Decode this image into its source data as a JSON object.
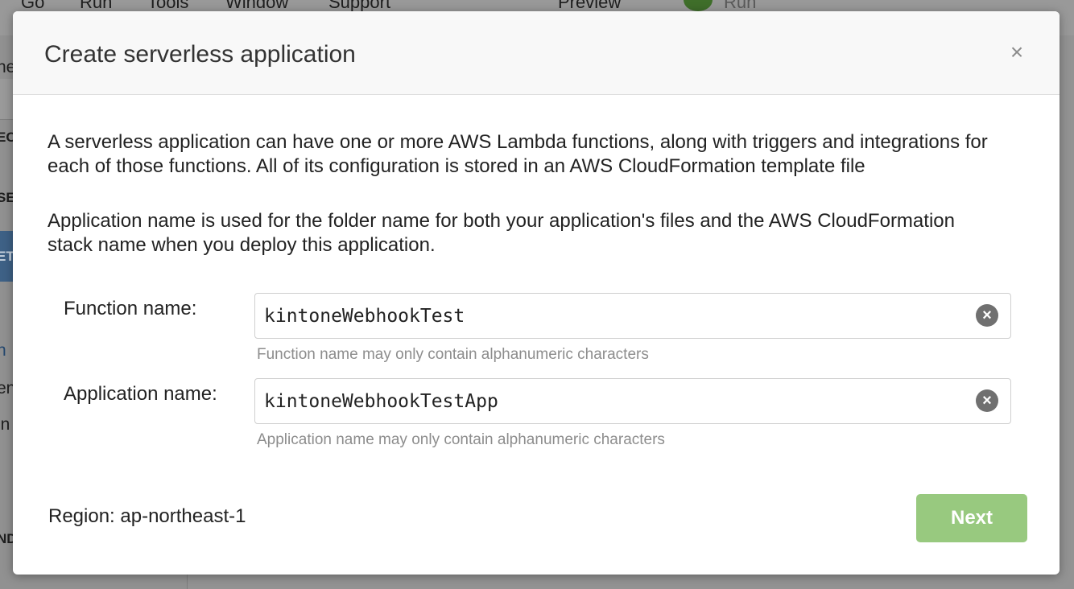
{
  "background": {
    "menu": [
      "Go",
      "Run",
      "Tools",
      "Window",
      "Support"
    ],
    "preview_label": "Preview",
    "run_label": "Run",
    "sidebar_fragments": [
      "ne",
      "EC",
      "SE",
      "ET",
      "n",
      "en",
      "in",
      "ND"
    ]
  },
  "dialog": {
    "title": "Create serverless application",
    "close_symbol": "×",
    "description_1": "A serverless application can have one or more AWS Lambda functions, along with triggers and integrations for each of those functions. All of its configuration is stored in an AWS CloudFormation template file",
    "description_2": "Application name is used for the folder name for both your application's files and the AWS CloudFormation stack name when you deploy this application.",
    "function_field": {
      "label": "Function name:",
      "value": "kintoneWebhookTest",
      "hint": "Function name may only contain alphanumeric characters",
      "clear_symbol": "×"
    },
    "application_field": {
      "label": "Application name:",
      "value": "kintoneWebhookTestApp",
      "hint": "Application name may only contain alphanumeric characters",
      "clear_symbol": "×"
    },
    "region": "Region: ap-northeast-1",
    "next_label": "Next"
  },
  "colors": {
    "next_button": "#98c97f",
    "overlay": "#8f8f8f",
    "hint_text": "#8d8d8d"
  }
}
